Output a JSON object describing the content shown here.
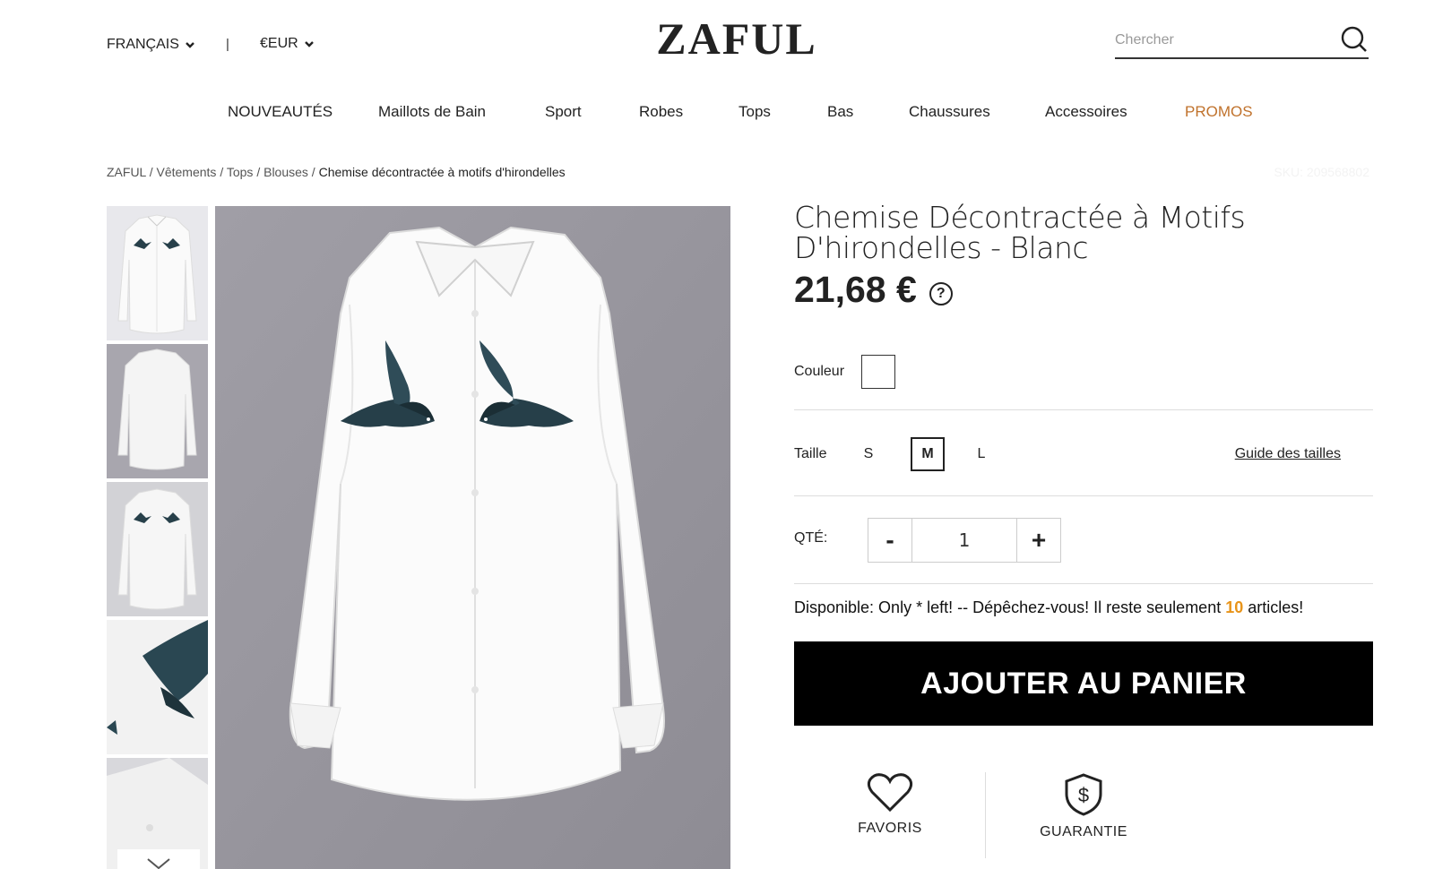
{
  "header": {
    "language": "FRANÇAIS",
    "separator": "|",
    "currency": "€EUR",
    "logo": "ZAFUL",
    "search_placeholder": "Chercher"
  },
  "nav": {
    "items": [
      "NOUVEAUTÉS",
      "Maillots de Bain",
      "Sport",
      "Robes",
      "Tops",
      "Bas",
      "Chaussures",
      "Accessoires",
      "PROMOS"
    ]
  },
  "breadcrumb": {
    "home": "ZAFUL",
    "sep": " / ",
    "level1": "Vêtements",
    "level2": "Tops",
    "level3": "Blouses",
    "current": "Chemise décontractée à motifs d'hirondelles"
  },
  "sku": "SKU: 209568802",
  "product": {
    "title": "Chemise Décontractée à Motifs D'hirondelles - Blanc",
    "price": "21,68 €",
    "help_symbol": "?"
  },
  "options": {
    "color_label": "Couleur",
    "selected_color": "#ffffff",
    "size_label": "Taille",
    "sizes": [
      "S",
      "M",
      "L"
    ],
    "selected_size": "M",
    "size_guide": "Guide des tailles",
    "qty_label": "QTÉ:",
    "qty_minus": "-",
    "qty_plus": "+",
    "qty_value": "1"
  },
  "availability": {
    "text_before": "Disponible: Only * left! -- Dépêchez-vous! Il reste seulement ",
    "count": "10",
    "text_after": " articles!"
  },
  "cart": {
    "add_label": "AJOUTER AU PANIER"
  },
  "actions": {
    "favorites": "FAVORIS",
    "guarantee": "GUARANTIE"
  },
  "colors": {
    "promo": "#c0722c",
    "stock_count": "#e8941a",
    "cart_button": "#000000",
    "image_background": "#9d9ba3"
  }
}
